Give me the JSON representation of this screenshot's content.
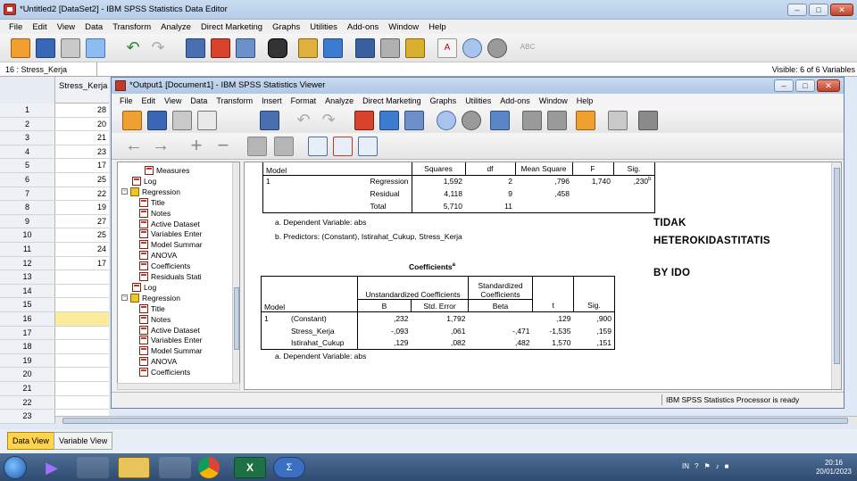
{
  "window": {
    "title": "*Untitled2 [DataSet2] - IBM SPSS Statistics Data Editor"
  },
  "menu": [
    "File",
    "Edit",
    "View",
    "Data",
    "Transform",
    "Analyze",
    "Direct Marketing",
    "Graphs",
    "Utilities",
    "Add-ons",
    "Window",
    "Help"
  ],
  "cell_info": {
    "ref": "16 : Stress_Kerja",
    "visible": "Visible: 6 of 6 Variables"
  },
  "grid": {
    "column": "Stress_Kerja",
    "rows": [
      {
        "n": "1",
        "v": "28"
      },
      {
        "n": "2",
        "v": "20"
      },
      {
        "n": "3",
        "v": "21"
      },
      {
        "n": "4",
        "v": "23"
      },
      {
        "n": "5",
        "v": "17"
      },
      {
        "n": "6",
        "v": "25"
      },
      {
        "n": "7",
        "v": "22"
      },
      {
        "n": "8",
        "v": "19"
      },
      {
        "n": "9",
        "v": "27"
      },
      {
        "n": "10",
        "v": "25"
      },
      {
        "n": "11",
        "v": "24"
      },
      {
        "n": "12",
        "v": "17"
      },
      {
        "n": "13",
        "v": ""
      },
      {
        "n": "14",
        "v": ""
      },
      {
        "n": "15",
        "v": ""
      },
      {
        "n": "16",
        "v": ""
      },
      {
        "n": "17",
        "v": ""
      },
      {
        "n": "18",
        "v": ""
      },
      {
        "n": "19",
        "v": ""
      },
      {
        "n": "20",
        "v": ""
      },
      {
        "n": "21",
        "v": ""
      },
      {
        "n": "22",
        "v": ""
      },
      {
        "n": "23",
        "v": ""
      }
    ]
  },
  "tabs": {
    "data_view": "Data View",
    "variable_view": "Variable View"
  },
  "viewer": {
    "title": "*Output1 [Document1] - IBM SPSS Statistics Viewer",
    "menu": [
      "File",
      "Edit",
      "View",
      "Data",
      "Transform",
      "Insert",
      "Format",
      "Analyze",
      "Direct Marketing",
      "Graphs",
      "Utilities",
      "Add-ons",
      "Window",
      "Help"
    ],
    "status": "IBM SPSS Statistics Processor is ready"
  },
  "outline": {
    "items": [
      {
        "label": "Measures",
        "kind": "page"
      },
      {
        "label": "Log",
        "kind": "page"
      },
      {
        "label": "Regression",
        "kind": "book"
      },
      {
        "label": "Title",
        "kind": "page"
      },
      {
        "label": "Notes",
        "kind": "page"
      },
      {
        "label": "Active Dataset",
        "kind": "page"
      },
      {
        "label": "Variables Enter",
        "kind": "page"
      },
      {
        "label": "Model Summar",
        "kind": "page"
      },
      {
        "label": "ANOVA",
        "kind": "page"
      },
      {
        "label": "Coefficients",
        "kind": "page"
      },
      {
        "label": "Residuals Stati",
        "kind": "page"
      },
      {
        "label": "Log",
        "kind": "page"
      },
      {
        "label": "Regression",
        "kind": "book"
      },
      {
        "label": "Title",
        "kind": "page"
      },
      {
        "label": "Notes",
        "kind": "page"
      },
      {
        "label": "Active Dataset",
        "kind": "page"
      },
      {
        "label": "Variables Enter",
        "kind": "page"
      },
      {
        "label": "Model Summar",
        "kind": "page"
      },
      {
        "label": "ANOVA",
        "kind": "page"
      },
      {
        "label": "Coefficients",
        "kind": "page"
      }
    ]
  },
  "anova": {
    "head_model": "Model",
    "head_ss": "Squares",
    "head_df": "df",
    "head_ms": "Mean Square",
    "head_f": "F",
    "head_sig": "Sig.",
    "model_no": "1",
    "rows": [
      {
        "label": "Regression",
        "ss": "1,592",
        "df": "2",
        "ms": ",796",
        "f": "1,740",
        "sig": ",230",
        "sup": "b"
      },
      {
        "label": "Residual",
        "ss": "4,118",
        "df": "9",
        "ms": ",458",
        "f": "",
        "sig": "",
        "sup": ""
      },
      {
        "label": "Total",
        "ss": "5,710",
        "df": "11",
        "ms": "",
        "f": "",
        "sig": "",
        "sup": ""
      }
    ],
    "note_a": "a. Dependent Variable: abs",
    "note_b": "b. Predictors: (Constant), Istirahat_Cukup, Stress_Kerja"
  },
  "coefficients": {
    "title": "Coefficients",
    "title_sup": "a",
    "unstd": "Unstandardized Coefficients",
    "std1": "Standardized",
    "std2": "Coefficients",
    "head_model": "Model",
    "head_b": "B",
    "head_se": "Std. Error",
    "head_beta": "Beta",
    "head_t": "t",
    "head_sig": "Sig.",
    "model_no": "1",
    "rows": [
      {
        "label": "(Constant)",
        "b": ",232",
        "se": "1,792",
        "beta": "",
        "t": ",129",
        "sig": ",900"
      },
      {
        "label": "Stress_Kerja",
        "b": "-,093",
        "se": ",061",
        "beta": "-,471",
        "t": "-1,535",
        "sig": ",159"
      },
      {
        "label": "Istirahat_Cukup",
        "b": ",129",
        "se": ",082",
        "beta": ",482",
        "t": "1,570",
        "sig": ",151"
      }
    ],
    "note": "a. Dependent Variable: abs"
  },
  "annotation": {
    "line1": "TIDAK",
    "line2": "HETEROKIDASTITATIS",
    "line3": "BY IDO"
  },
  "taskbar": {
    "lang": "IN",
    "time": "20:16",
    "date": "20/01/2023"
  },
  "colors": {
    "accent": "#ffd34d",
    "selection": "#fbeb9b",
    "title_bar": "#b6cce8"
  }
}
